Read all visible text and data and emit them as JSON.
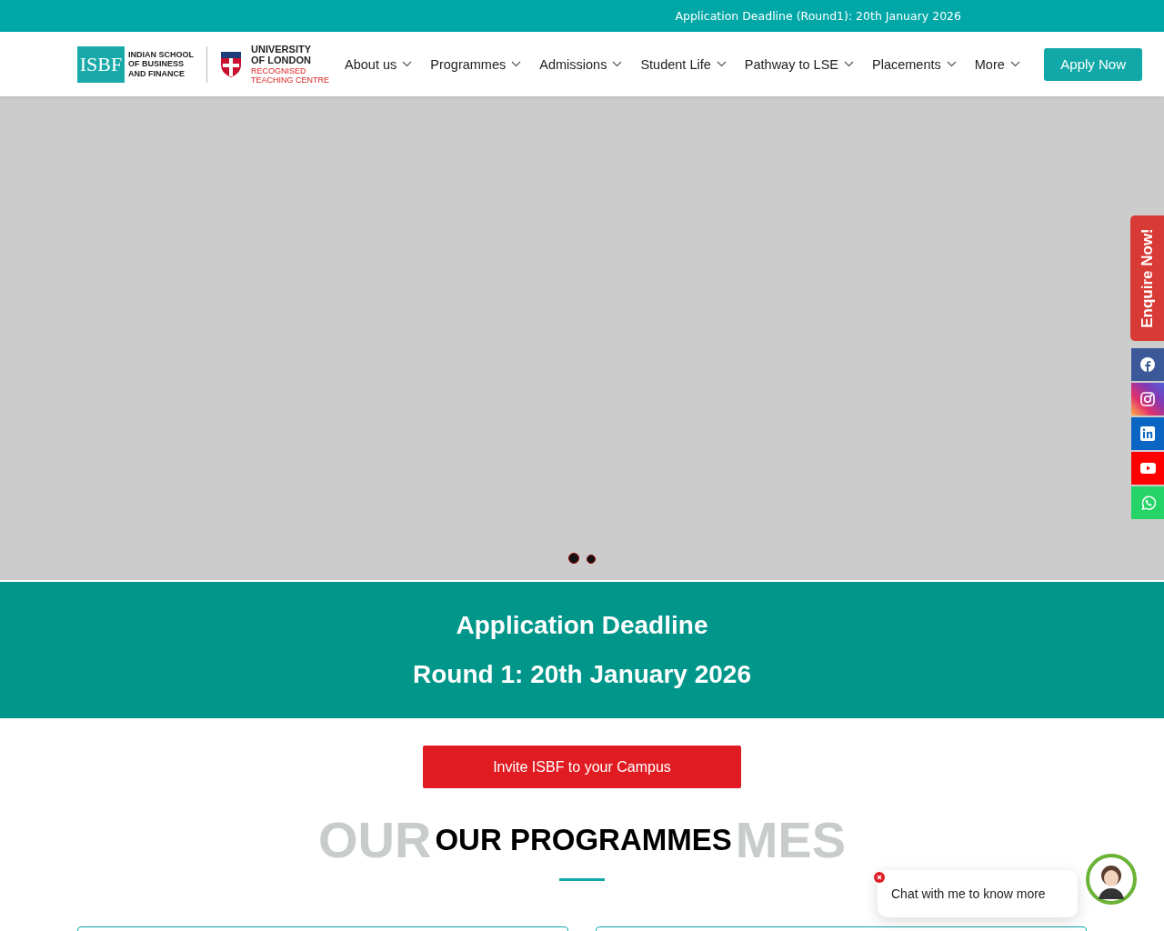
{
  "announcement": "Application Deadline (Round1): 20th January 2026",
  "logo": {
    "mark": "ISBF",
    "name_lines": [
      "INDIAN SCHOOL",
      "OF BUSINESS",
      "AND FINANCE"
    ]
  },
  "partner_logo": {
    "lines": [
      "UNIVERSITY",
      "OF LONDON"
    ],
    "sub_lines": [
      "RECOGNISED",
      "TEACHING CENTRE"
    ]
  },
  "nav": {
    "items": [
      {
        "label": "About us"
      },
      {
        "label": "Programmes"
      },
      {
        "label": "Admissions"
      },
      {
        "label": "Student Life"
      },
      {
        "label": "Pathway to LSE"
      },
      {
        "label": "Placements"
      },
      {
        "label": "More"
      }
    ],
    "cta": "Apply Now"
  },
  "hero": {
    "slides": [
      {
        "selected": true
      },
      {
        "selected": false
      }
    ]
  },
  "side_bar": {
    "enquire": "Enquire Now!",
    "socials": [
      {
        "kind": "facebook"
      },
      {
        "kind": "instagram"
      },
      {
        "kind": "linkedin"
      },
      {
        "kind": "youtube"
      },
      {
        "kind": "whatsapp"
      }
    ]
  },
  "deadline_band": {
    "title": "Application Deadline",
    "subtitle": "Round 1: 20th January 2026"
  },
  "invite_button": "Invite ISBF to your Campus",
  "programmes": {
    "backdrop_left": "OUR",
    "backdrop_right": "MES",
    "heading": "OUR PROGRAMMES",
    "cards": [
      {
        "kind": "card"
      },
      {
        "kind": "card"
      }
    ]
  },
  "chat": {
    "message": "Chat with me to know more"
  }
}
